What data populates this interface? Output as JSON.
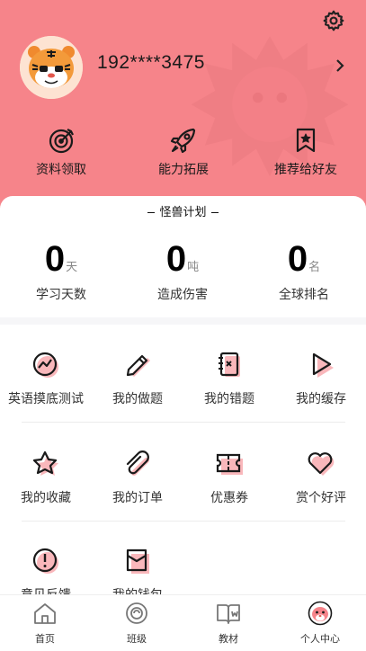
{
  "colors": {
    "header_bg": "#f6848a",
    "accent_pink": "#f6848a",
    "text": "#333333"
  },
  "profile": {
    "phone": "192****3475",
    "avatar_icon": "tiger-avatar"
  },
  "quick_actions": [
    {
      "label": "资料领取",
      "icon": "target-icon"
    },
    {
      "label": "能力拓展",
      "icon": "rocket-icon"
    },
    {
      "label": "推荐给好友",
      "icon": "bookmark-star-icon"
    }
  ],
  "plan": {
    "title": "怪兽计划",
    "stats": [
      {
        "value": "0",
        "unit": "天",
        "label": "学习天数"
      },
      {
        "value": "0",
        "unit": "吨",
        "label": "造成伤害"
      },
      {
        "value": "0",
        "unit": "名",
        "label": "全球排名"
      }
    ]
  },
  "menu": [
    {
      "label": "英语摸底测试",
      "icon": "trend-chart-icon"
    },
    {
      "label": "我的做题",
      "icon": "pencil-icon"
    },
    {
      "label": "我的错题",
      "icon": "wrong-notebook-icon"
    },
    {
      "label": "我的缓存",
      "icon": "play-icon"
    },
    {
      "label": "我的收藏",
      "icon": "star-icon"
    },
    {
      "label": "我的订单",
      "icon": "paperclip-icon"
    },
    {
      "label": "优惠券",
      "icon": "ticket-icon"
    },
    {
      "label": "赏个好评",
      "icon": "heart-icon"
    },
    {
      "label": "意见反馈",
      "icon": "alert-circle-icon"
    },
    {
      "label": "我的钱包",
      "icon": "wallet-icon"
    }
  ],
  "tabs": [
    {
      "label": "首页",
      "icon": "home-icon"
    },
    {
      "label": "班级",
      "icon": "class-icon"
    },
    {
      "label": "教材",
      "icon": "book-icon"
    },
    {
      "label": "个人中心",
      "icon": "tiger-profile-icon",
      "active": true
    }
  ]
}
